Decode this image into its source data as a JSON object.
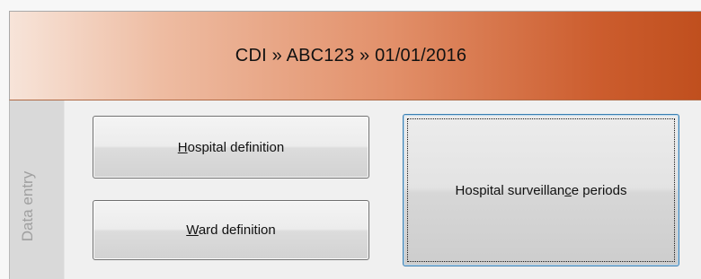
{
  "header": {
    "title": "CDI » ABC123 » 01/01/2016"
  },
  "side_tab": {
    "label": "Data entry"
  },
  "buttons": {
    "hospital_definition": {
      "mnemonic": "H",
      "rest": "ospital definition"
    },
    "ward_definition": {
      "mnemonic": "W",
      "rest": "ard definition"
    },
    "surveillance_periods": {
      "before": "Hospital surveillan",
      "mnemonic": "c",
      "after": "e periods"
    }
  },
  "colors": {
    "header_gradient_start": "#f7e4d9",
    "header_gradient_end": "#c04f1e",
    "focus_border": "#3c7fb1"
  }
}
